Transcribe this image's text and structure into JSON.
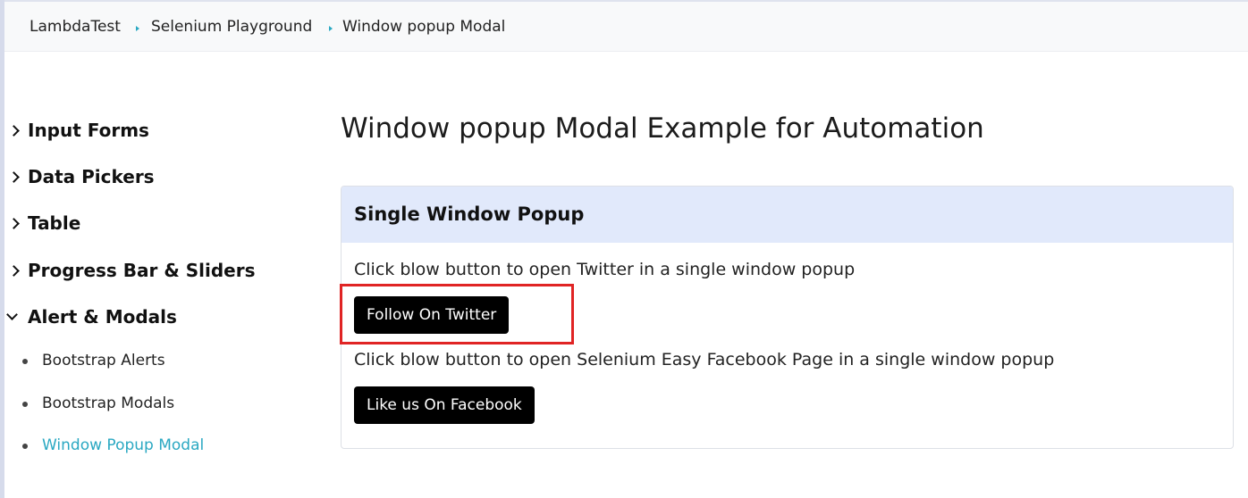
{
  "breadcrumb": {
    "items": [
      "LambdaTest",
      "Selenium Playground",
      "Window popup Modal"
    ],
    "separator_color": "#2aa8c2"
  },
  "sidebar": {
    "categories": [
      {
        "label": "Input Forms",
        "expanded": false
      },
      {
        "label": "Data Pickers",
        "expanded": false
      },
      {
        "label": "Table",
        "expanded": false
      },
      {
        "label": "Progress Bar & Sliders",
        "expanded": false
      },
      {
        "label": "Alert & Modals",
        "expanded": true
      }
    ],
    "subitems": [
      {
        "label": "Bootstrap Alerts",
        "active": false
      },
      {
        "label": "Bootstrap Modals",
        "active": false
      },
      {
        "label": "Window Popup Modal",
        "active": true
      }
    ],
    "active_color": "#2aa8c2"
  },
  "main": {
    "title": "Window popup Modal Example for Automation",
    "panel": {
      "title": "Single Window Popup",
      "header_bg": "#e1e9fb",
      "twitter_desc": "Click blow button to open Twitter in a single window popup",
      "twitter_button": "Follow On Twitter",
      "facebook_desc": "Click blow button to open Selenium Easy Facebook Page in a single window popup",
      "facebook_button": "Like us On Facebook"
    }
  },
  "annotation": {
    "highlight_color": "#e02424",
    "highlighted_element": "Follow On Twitter"
  }
}
